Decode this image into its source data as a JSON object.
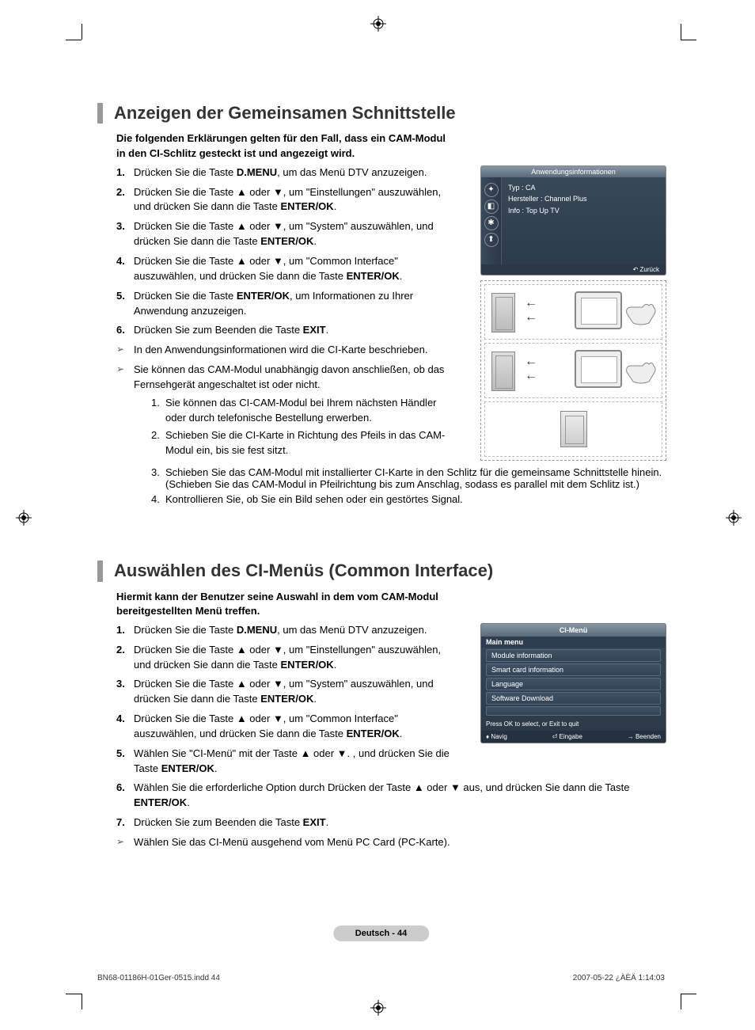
{
  "section1": {
    "title": "Anzeigen der Gemeinsamen Schnittstelle",
    "intro": "Die folgenden Erklärungen gelten für den Fall, dass ein CAM-Modul in den CI-Schlitz gesteckt ist und angezeigt wird.",
    "steps": [
      {
        "n": "1.",
        "pre": "Drücken Sie die Taste ",
        "bold": "D.MENU",
        "post": ", um das Menü DTV anzuzeigen."
      },
      {
        "n": "2.",
        "pre": "Drücken Sie die Taste ▲ oder ▼, um \"Einstellungen\" auszuwählen, und drücken Sie dann die Taste ",
        "bold": "ENTER/OK",
        "post": "."
      },
      {
        "n": "3.",
        "pre": "Drücken Sie die Taste ▲ oder ▼, um \"System\" auszuwählen, und drücken Sie dann die Taste ",
        "bold": "ENTER/OK",
        "post": "."
      },
      {
        "n": "4.",
        "pre": "Drücken Sie die Taste ▲ oder ▼, um \"Common Interface\" auszuwählen, und drücken Sie dann die Taste ",
        "bold": "ENTER/OK",
        "post": "."
      },
      {
        "n": "5.",
        "pre": "Drücken Sie die Taste ",
        "bold": "ENTER/OK",
        "post": ", um Informationen zu Ihrer Anwendung anzuzeigen."
      },
      {
        "n": "6.",
        "pre": "Drücken Sie zum Beenden die Taste ",
        "bold": "EXIT",
        "post": "."
      }
    ],
    "note1": "In den Anwendungsinformationen wird die CI-Karte beschrieben.",
    "note2": "Sie können das CAM-Modul unabhängig davon anschließen, ob das Fernsehgerät angeschaltet ist oder nicht.",
    "sublist": [
      {
        "n": "1.",
        "t": "Sie können das CI-CAM-Modul bei Ihrem nächsten Händler oder durch telefonische Bestellung erwerben."
      },
      {
        "n": "2.",
        "t": "Schieben Sie die CI-Karte in Richtung des Pfeils in das CAM-Modul ein, bis sie fest sitzt."
      },
      {
        "n": "3.",
        "t": "Schieben Sie das CAM-Modul mit installierter CI-Karte in den Schlitz für die gemeinsame Schnittstelle hinein. (Schieben Sie das CAM-Modul in Pfeilrichtung bis zum Anschlag, sodass es parallel mit dem Schlitz ist.)"
      },
      {
        "n": "4.",
        "t": "Kontrollieren Sie, ob Sie ein Bild sehen oder ein gestörtes Signal."
      }
    ],
    "osd": {
      "header": "Anwendungsinformationen",
      "line1": "Typ : CA",
      "line2": "Hersteller : Channel Plus",
      "line3": "Info : Top Up TV",
      "back": "Zurück"
    }
  },
  "section2": {
    "title": "Auswählen des CI-Menüs (Common Interface)",
    "intro": "Hiermit kann der Benutzer seine Auswahl in dem vom CAM-Modul bereitgestellten Menü treffen.",
    "steps": [
      {
        "n": "1.",
        "pre": "Drücken Sie die Taste ",
        "bold": "D.MENU",
        "post": ", um das Menü DTV anzuzeigen."
      },
      {
        "n": "2.",
        "pre": "Drücken Sie die Taste ▲ oder ▼, um \"Einstellungen\" auszuwählen, und drücken Sie dann die Taste ",
        "bold": "ENTER/OK",
        "post": "."
      },
      {
        "n": "3.",
        "pre": "Drücken Sie die Taste ▲ oder ▼, um \"System\" auszuwählen, und drücken Sie dann die Taste ",
        "bold": "ENTER/OK",
        "post": "."
      },
      {
        "n": "4.",
        "pre": "Drücken Sie die Taste ▲ oder ▼, um \"Common Interface\" auszuwählen, und drücken Sie dann die Taste ",
        "bold": "ENTER/OK",
        "post": "."
      },
      {
        "n": "5.",
        "pre": "Wählen Sie \"CI-Menü\" mit der Taste ▲ oder ▼. , und drücken Sie die Taste ",
        "bold": "ENTER/OK",
        "post": "."
      },
      {
        "n": "6.",
        "pre": "Wählen Sie die erforderliche Option durch Drücken der Taste ▲ oder ▼ aus, und drücken Sie dann die Taste ",
        "bold": "ENTER/OK",
        "post": "."
      },
      {
        "n": "7.",
        "pre": "Drücken Sie zum Beenden die Taste ",
        "bold": "EXIT",
        "post": "."
      }
    ],
    "note1": "Wählen Sie das CI-Menü ausgehend vom Menü PC Card (PC-Karte).",
    "menu": {
      "title": "CI-Menü",
      "main": "Main menu",
      "items": [
        "Module information",
        "Smart card information",
        "Language",
        "Software Download"
      ],
      "hint": "Press OK to select, or Exit to quit",
      "nav": "Navig",
      "enter": "Eingabe",
      "exit": "Beenden"
    }
  },
  "footer": {
    "pill": "Deutsch - 44",
    "file": "BN68-01186H-01Ger-0515.indd   44",
    "stamp": "2007-05-22   ¿ÀÈÄ 1:14:03"
  }
}
